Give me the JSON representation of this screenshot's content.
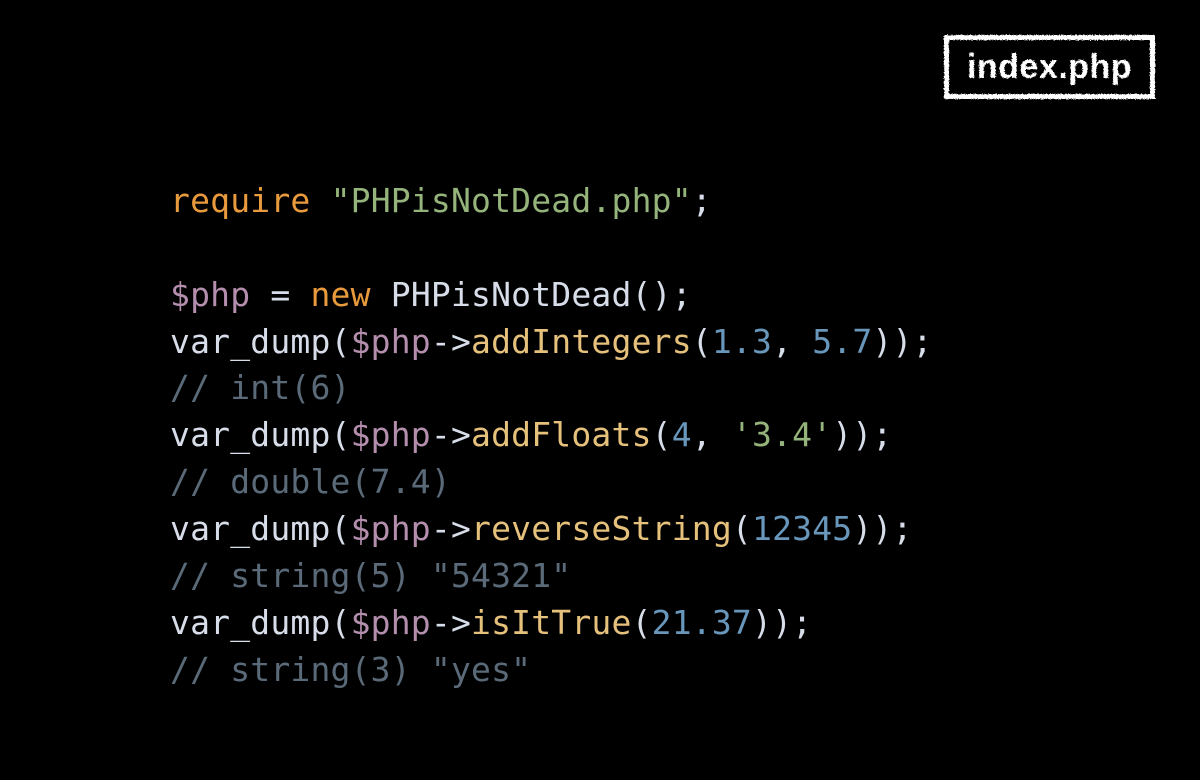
{
  "filename": "index.php",
  "colors": {
    "keyword": "#e89a3c",
    "string": "#95b47b",
    "variable": "#b48ead",
    "punct": "#d8dee9",
    "default": "#d8dee9",
    "func": "#e6c17c",
    "number": "#6897bb",
    "comment": "#5a6a78"
  },
  "code": [
    [
      {
        "c": "keyword",
        "t": "require"
      },
      {
        "c": "default",
        "t": " "
      },
      {
        "c": "string",
        "t": "\"PHPisNotDead.php\""
      },
      {
        "c": "punct",
        "t": ";"
      }
    ],
    [],
    [
      {
        "c": "variable",
        "t": "$php"
      },
      {
        "c": "default",
        "t": " = "
      },
      {
        "c": "keyword",
        "t": "new"
      },
      {
        "c": "default",
        "t": " PHPisNotDead();"
      }
    ],
    [
      {
        "c": "default",
        "t": "var_dump("
      },
      {
        "c": "variable",
        "t": "$php"
      },
      {
        "c": "default",
        "t": "->"
      },
      {
        "c": "func",
        "t": "addIntegers"
      },
      {
        "c": "default",
        "t": "("
      },
      {
        "c": "number",
        "t": "1.3"
      },
      {
        "c": "default",
        "t": ", "
      },
      {
        "c": "number",
        "t": "5.7"
      },
      {
        "c": "default",
        "t": "));"
      }
    ],
    [
      {
        "c": "comment",
        "t": "// int(6)"
      }
    ],
    [
      {
        "c": "default",
        "t": "var_dump("
      },
      {
        "c": "variable",
        "t": "$php"
      },
      {
        "c": "default",
        "t": "->"
      },
      {
        "c": "func",
        "t": "addFloats"
      },
      {
        "c": "default",
        "t": "("
      },
      {
        "c": "number",
        "t": "4"
      },
      {
        "c": "default",
        "t": ", "
      },
      {
        "c": "string",
        "t": "'3.4'"
      },
      {
        "c": "default",
        "t": "));"
      }
    ],
    [
      {
        "c": "comment",
        "t": "// double(7.4)"
      }
    ],
    [
      {
        "c": "default",
        "t": "var_dump("
      },
      {
        "c": "variable",
        "t": "$php"
      },
      {
        "c": "default",
        "t": "->"
      },
      {
        "c": "func",
        "t": "reverseString"
      },
      {
        "c": "default",
        "t": "("
      },
      {
        "c": "number",
        "t": "12345"
      },
      {
        "c": "default",
        "t": "));"
      }
    ],
    [
      {
        "c": "comment",
        "t": "// string(5) \"54321\""
      }
    ],
    [
      {
        "c": "default",
        "t": "var_dump("
      },
      {
        "c": "variable",
        "t": "$php"
      },
      {
        "c": "default",
        "t": "->"
      },
      {
        "c": "func",
        "t": "isItTrue"
      },
      {
        "c": "default",
        "t": "("
      },
      {
        "c": "number",
        "t": "21.37"
      },
      {
        "c": "default",
        "t": "));"
      }
    ],
    [
      {
        "c": "comment",
        "t": "// string(3) \"yes\""
      }
    ]
  ]
}
